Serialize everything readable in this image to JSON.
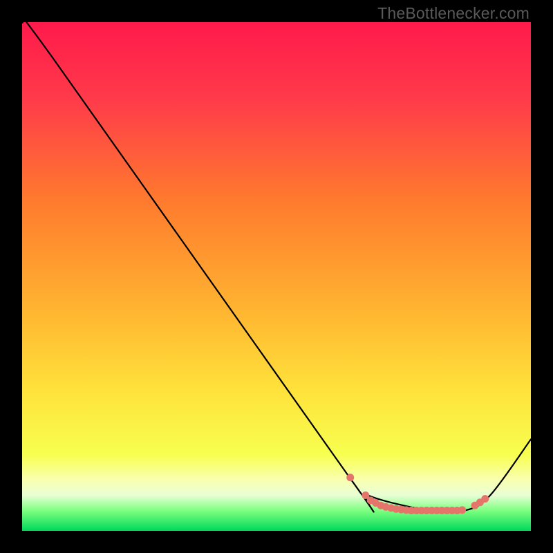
{
  "watermark": "TheBottlenecker.com",
  "colors": {
    "gradient_top": "#ff1a4b",
    "gradient_mid1": "#ff7a2e",
    "gradient_mid2": "#ffe13a",
    "gradient_mid3": "#f9ff57",
    "gradient_bottom_strip": "#e8ffd5",
    "gradient_bottom": "#00d85a",
    "line": "#000000",
    "markers": "#e5756b"
  },
  "chart_data": {
    "type": "line",
    "title": "",
    "xlabel": "",
    "ylabel": "",
    "xlim": [
      0,
      100
    ],
    "ylim": [
      0,
      100
    ],
    "series": [
      {
        "name": "curve",
        "x": [
          0,
          6,
          64,
          68,
          80,
          87,
          92,
          100
        ],
        "y": [
          100,
          93,
          11,
          7,
          4,
          4,
          7,
          18
        ]
      }
    ],
    "markers": {
      "name": "sweet-spot",
      "x": [
        64.5,
        67.5,
        68.5,
        69.5,
        70.5,
        71.5,
        72.5,
        73.5,
        74.5,
        75.5,
        76.5,
        77.5,
        78.5,
        79.5,
        80.5,
        81.5,
        82.5,
        83.5,
        84.5,
        85.5,
        86.5,
        89,
        90,
        91
      ],
      "y": [
        10.5,
        7,
        6,
        5.5,
        5,
        4.7,
        4.5,
        4.3,
        4.2,
        4.1,
        4,
        4,
        4,
        4,
        4,
        4,
        4,
        4,
        4,
        4,
        4.1,
        5,
        5.6,
        6.3
      ]
    }
  }
}
